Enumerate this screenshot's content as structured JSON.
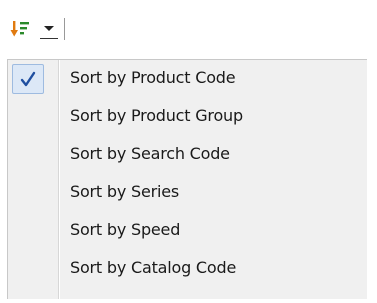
{
  "toolbar": {
    "sort_icon": "sort-descending-icon",
    "dropdown_icon": "chevron-down-icon",
    "sort_icon_colors": {
      "arrow": "#e07a10",
      "lines": "#2b8a2b"
    }
  },
  "menu": {
    "checked_index": 0,
    "items": [
      {
        "label": "Sort by Product Code",
        "checked": true
      },
      {
        "label": "Sort by Product Group",
        "checked": false
      },
      {
        "label": "Sort by Search Code",
        "checked": false
      },
      {
        "label": "Sort by Series",
        "checked": false
      },
      {
        "label": "Sort by Speed",
        "checked": false
      },
      {
        "label": "Sort by Catalog Code",
        "checked": false
      }
    ],
    "check_icon": "checkmark-icon",
    "colors": {
      "background": "#f0f0f0",
      "check": "#1f4fa0",
      "check_highlight": "#dce8f7"
    }
  }
}
